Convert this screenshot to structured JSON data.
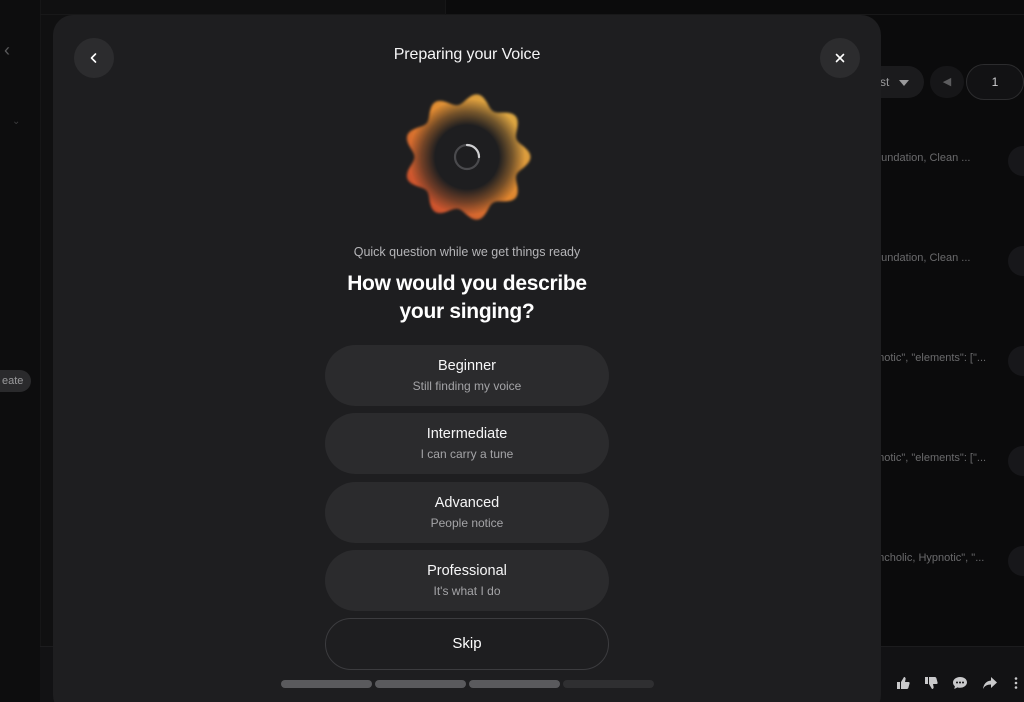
{
  "background": {
    "create_label": "eate",
    "sort_label": "st",
    "page_number": "1",
    "snippets": [
      "foundation, Clean ...",
      "foundation, Clean ...",
      "onotic\", \"elements\": [\"...",
      "onotic\", \"elements\": [\"...",
      "ancholic, Hypnotic\", \"..."
    ]
  },
  "modal": {
    "title": "Preparing your Voice",
    "back_icon": "chevron-left-icon",
    "close_icon": "close-icon",
    "subtitle": "Quick question while we get things ready",
    "question": "How would you describe your singing?",
    "options": [
      {
        "title": "Beginner",
        "subtitle": "Still finding my voice"
      },
      {
        "title": "Intermediate",
        "subtitle": "I can carry a tune"
      },
      {
        "title": "Advanced",
        "subtitle": "People notice"
      },
      {
        "title": "Professional",
        "subtitle": "It's what I do"
      }
    ],
    "skip_label": "Skip",
    "progress": {
      "completed_steps": 3,
      "total_steps": 4
    }
  },
  "colors": {
    "modal_bg": "#1e1e20",
    "option_bg": "#2b2b2d",
    "orb_gradient": [
      "#d24a2e",
      "#e08a30",
      "#d9b24a"
    ],
    "progress_active": "#5a5a5d",
    "progress_inactive": "#2f2f31"
  }
}
